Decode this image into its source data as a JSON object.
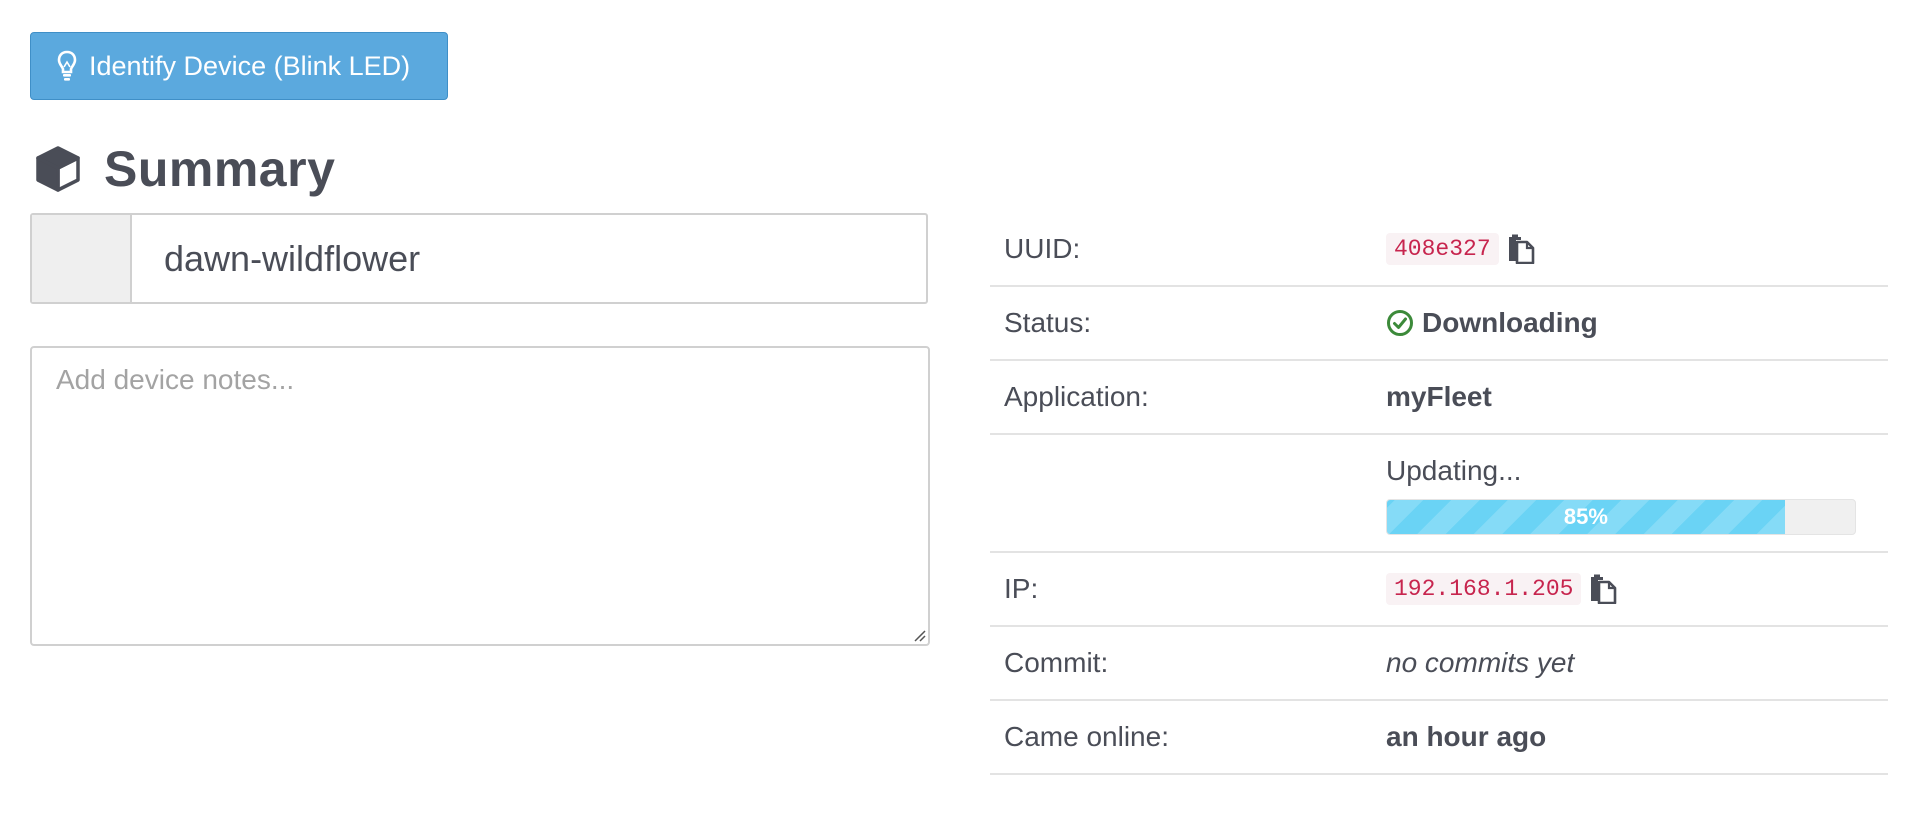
{
  "toolbar": {
    "identify_label": "Identify Device (Blink LED)",
    "identify_icon": "lightbulb-icon"
  },
  "summary": {
    "title": "Summary",
    "icon": "cube-icon",
    "device_name": "dawn-wildflower",
    "notes_placeholder": "Add device notes...",
    "notes_value": ""
  },
  "details": {
    "uuid": {
      "label": "UUID:",
      "value": "408e327",
      "icon": "copy-icon"
    },
    "status": {
      "label": "Status:",
      "value": "Downloading",
      "icon": "check-circle-icon",
      "color": "#3c8a3a"
    },
    "application": {
      "label": "Application:",
      "value": "myFleet"
    },
    "update": {
      "label": "",
      "text": "Updating...",
      "progress_percent": 85,
      "progress_label": "85%"
    },
    "ip": {
      "label": "IP:",
      "value": "192.168.1.205",
      "icon": "copy-icon"
    },
    "commit": {
      "label": "Commit:",
      "value": "no commits yet"
    },
    "came_online": {
      "label": "Came online:",
      "value": "an hour ago"
    }
  },
  "colors": {
    "button_bg": "#5ba9de",
    "progress_fill": "#6ad3f5",
    "code_text": "#c7254e",
    "code_bg": "#f9f2f4"
  }
}
